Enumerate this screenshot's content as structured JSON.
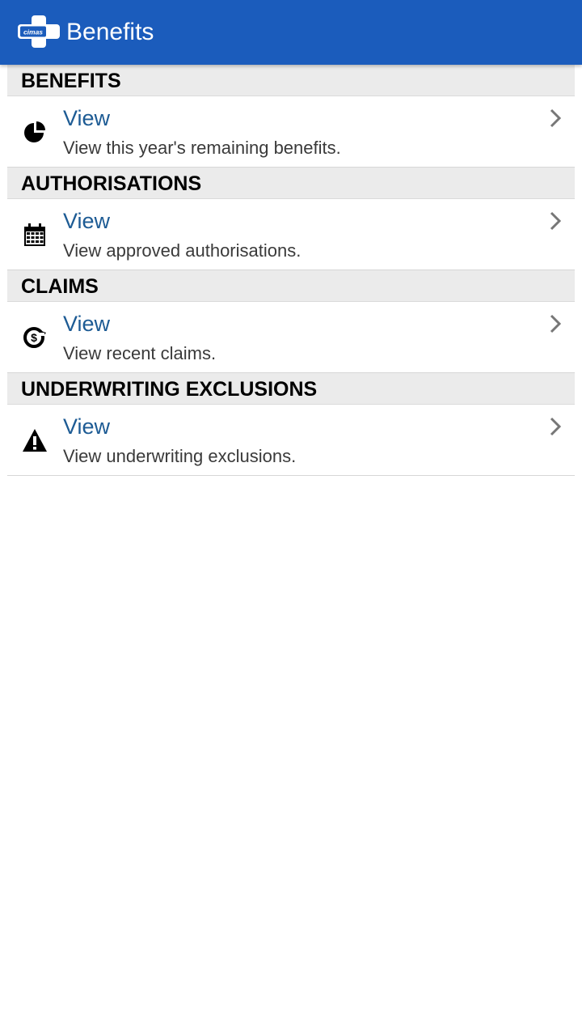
{
  "app_bar": {
    "title": "Benefits",
    "logo_text": "cimas",
    "background_color": "#1b5cbc"
  },
  "sections": [
    {
      "header": "BENEFITS",
      "item": {
        "title": "View",
        "subtitle": "View this year's remaining benefits.",
        "icon": "pie-chart-icon"
      }
    },
    {
      "header": "AUTHORISATIONS",
      "item": {
        "title": "View",
        "subtitle": "View approved authorisations.",
        "icon": "calendar-icon"
      }
    },
    {
      "header": "CLAIMS",
      "item": {
        "title": "View",
        "subtitle": "View recent claims.",
        "icon": "dollar-refresh-icon"
      }
    },
    {
      "header": "UNDERWRITING EXCLUSIONS",
      "item": {
        "title": "View",
        "subtitle": "View underwriting exclusions.",
        "icon": "warning-icon"
      }
    }
  ],
  "colors": {
    "link": "#1d5b94",
    "section_header_bg": "#ebebeb"
  }
}
